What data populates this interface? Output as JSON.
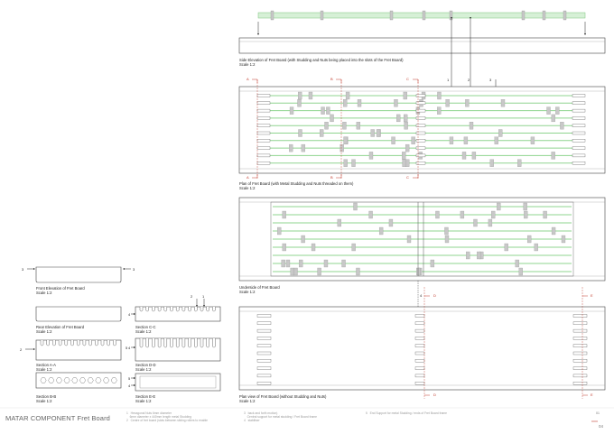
{
  "captions": {
    "side_elevation": {
      "title": "Side Elevation of Fret Board (with Studding and Nuts being placed into the slots of the Fret Board)",
      "scale": "Scale 1:2"
    },
    "plan": {
      "title": "Plan of Fret Board (with Metal Studding and Nuts threaded on them)",
      "scale": "Scale 1:2"
    },
    "underside": {
      "title": "Underside of Fret Board",
      "scale": "Scale 1:2"
    },
    "plan_view": {
      "title": "Plan view of Fret Board (without Studding and Nuts)",
      "scale": "Scale 1:2"
    },
    "front_elevation": {
      "title": "Front Elevation of Fret Board",
      "scale": "Scale 1:2"
    },
    "rear_elevation": {
      "title": "Rear Elevation of Fret Board",
      "scale": "Scale 1:2"
    },
    "section_aa": {
      "title": "Section A-A",
      "scale": "Scale 1:2"
    },
    "section_bb": {
      "title": "Section B-B",
      "scale": "Scale 1:2"
    },
    "section_cc": {
      "title": "Section C-C",
      "scale": "Scale 1:2"
    },
    "section_dd": {
      "title": "Section D-D",
      "scale": "Scale 1:2"
    },
    "section_ee": {
      "title": "Section E-E",
      "scale": "Scale 1:2"
    }
  },
  "section_marks": {
    "a": "A",
    "b": "B",
    "c": "C",
    "d": "D",
    "e": "E",
    "n1": "1",
    "n2": "2",
    "n3": "3",
    "n4": "4",
    "n5": "5"
  },
  "footer": {
    "title": "MATAR COMPONENT Fret Board",
    "notes": [
      {
        "num": "1",
        "lines": [
          "Hexagonal Nuts 6mm diameter",
          "6mm diameter x 440mm length metal Studding"
        ]
      },
      {
        "num": "2",
        "lines": [
          "Centre of fret board (slots between sliding rollers to enable"
        ]
      },
      {
        "num": "3",
        "lines": [
          "back and forth motion)",
          "Central support for metal studding / Fret Board frame"
        ]
      },
      {
        "num": "4",
        "lines": [
          "stabiliser"
        ]
      },
      {
        "num": "5",
        "lines": [
          "End Support for metal Studding / ends of Fret Board frame"
        ]
      }
    ],
    "page_number": "04",
    "page_small": "01"
  },
  "colors": {
    "line": "#333333",
    "stud": "#8fd48f",
    "nut": "#c8c8c8",
    "arrow_red": "#c0392b"
  }
}
